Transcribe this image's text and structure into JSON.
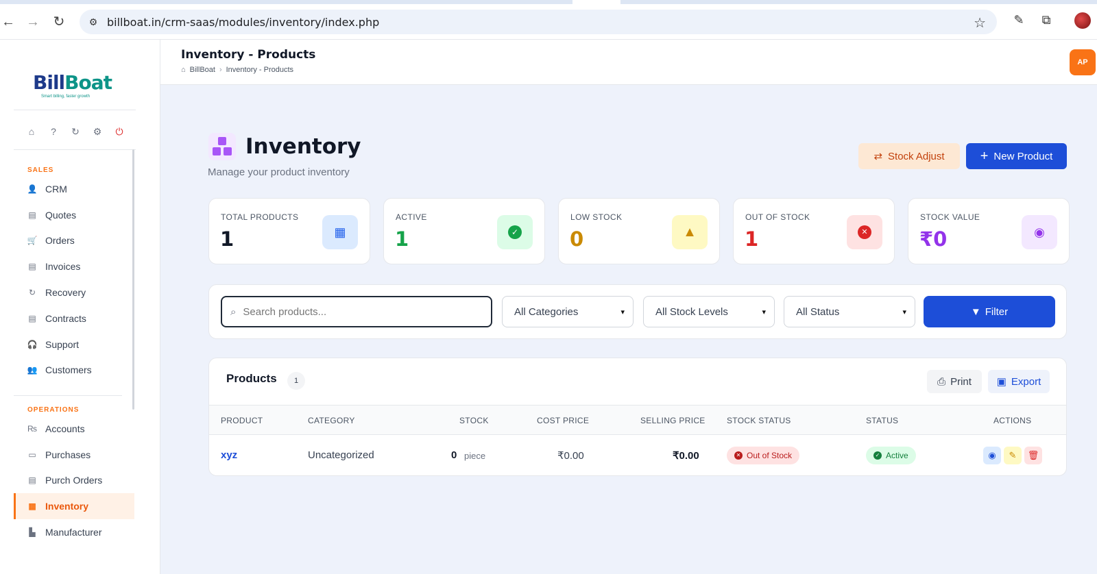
{
  "browser": {
    "url": "billboat.in/crm-saas/modules/inventory/index.php"
  },
  "sidebar": {
    "logo": {
      "part1": "Bill",
      "part2": "Boat",
      "tagline": "Smart billing, faster growth"
    },
    "sections": [
      {
        "title": "SALES",
        "items": [
          "CRM",
          "Quotes",
          "Orders",
          "Invoices",
          "Recovery",
          "Contracts",
          "Support",
          "Customers"
        ]
      },
      {
        "title": "OPERATIONS",
        "items": [
          "Accounts",
          "Purchases",
          "Purch Orders",
          "Inventory",
          "Manufacturer"
        ]
      }
    ],
    "active_item": "Inventory"
  },
  "header": {
    "title": "Inventory - Products",
    "breadcrumb": [
      "BillBoat",
      "Inventory - Products"
    ],
    "avatar_initials": "AP"
  },
  "main": {
    "title": "Inventory",
    "subtitle": "Manage your product inventory",
    "stock_adjust_label": "Stock Adjust",
    "new_product_label": "New Product",
    "stats": [
      {
        "label": "TOTAL PRODUCTS",
        "value": "1",
        "color": "#111827",
        "icon_bg": "#dbeafe",
        "icon_color": "#2563eb"
      },
      {
        "label": "ACTIVE",
        "value": "1",
        "color": "#16a34a",
        "icon_bg": "#dcfce7",
        "icon_color": "#16a34a"
      },
      {
        "label": "LOW STOCK",
        "value": "0",
        "color": "#ca8a04",
        "icon_bg": "#fef9c3",
        "icon_color": "#ca8a04"
      },
      {
        "label": "OUT OF STOCK",
        "value": "1",
        "color": "#dc2626",
        "icon_bg": "#fee2e2",
        "icon_color": "#dc2626"
      },
      {
        "label": "STOCK VALUE",
        "value": "₹0",
        "color": "#9333ea",
        "icon_bg": "#f3e8ff",
        "icon_color": "#9333ea"
      }
    ],
    "filters": {
      "search_placeholder": "Search products...",
      "category": "All Categories",
      "stock_level": "All Stock Levels",
      "status": "All Status",
      "filter_label": "Filter"
    },
    "products": {
      "title": "Products",
      "count": "1",
      "print_label": "Print",
      "export_label": "Export",
      "columns": [
        "PRODUCT",
        "CATEGORY",
        "STOCK",
        "COST PRICE",
        "SELLING PRICE",
        "STOCK STATUS",
        "STATUS",
        "ACTIONS"
      ],
      "rows": [
        {
          "product": "xyz",
          "category": "Uncategorized",
          "stock": "0",
          "unit": "piece",
          "cost_price": "₹0.00",
          "selling_price": "₹0.00",
          "stock_status": "Out of Stock",
          "status": "Active"
        }
      ]
    }
  }
}
